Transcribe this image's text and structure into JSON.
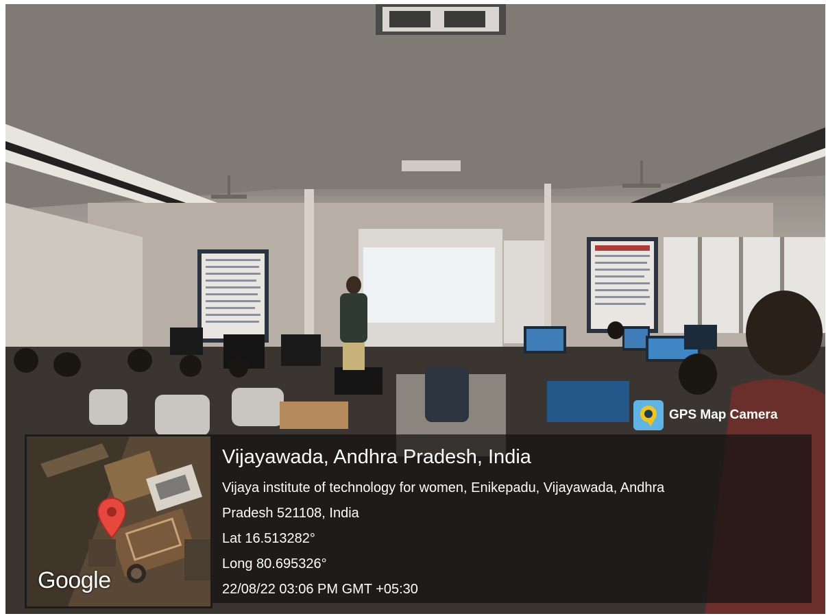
{
  "overlay": {
    "brand_label": "GPS Map Camera",
    "map_label": "Google",
    "location_title": "Vijayawada, Andhra Pradesh, India",
    "address_line1": "Vijaya institute of technology for women, Enikepadu, Vijayawada, Andhra",
    "address_line2": "Pradesh 521108, India",
    "latitude": "Lat 16.513282°",
    "longitude": "Long 80.695326°",
    "timestamp": "22/08/22 03:06 PM GMT +05:30"
  },
  "icons": {
    "brand": "gps-map-camera-logo",
    "map_pin": "map-pin-icon"
  },
  "colors": {
    "panel_background": "#141212",
    "pin": "#e8473d",
    "brand_logo": "#5fb4e6",
    "text": "#ffffff"
  }
}
